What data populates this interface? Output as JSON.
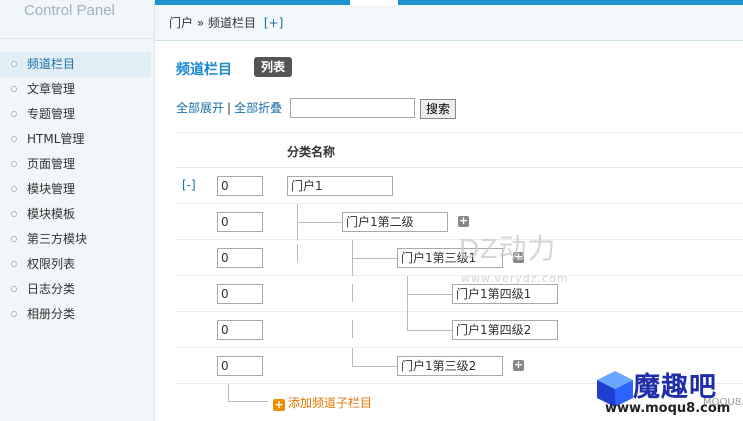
{
  "sidebar": {
    "title": "Control Panel",
    "items": [
      {
        "label": "频道栏目"
      },
      {
        "label": "文章管理"
      },
      {
        "label": "专题管理"
      },
      {
        "label": "HTML管理"
      },
      {
        "label": "页面管理"
      },
      {
        "label": "模块管理"
      },
      {
        "label": "模块模板"
      },
      {
        "label": "第三方模块"
      },
      {
        "label": "权限列表"
      },
      {
        "label": "日志分类"
      },
      {
        "label": "相册分类"
      }
    ]
  },
  "breadcrumb": {
    "root": "门户",
    "separator": "»",
    "current": "频道栏目",
    "add": "[+]"
  },
  "page": {
    "title": "频道栏目",
    "badge": "列表"
  },
  "toolbar": {
    "expand_all": "全部展开",
    "divider": "|",
    "collapse_all": "全部折叠",
    "search_value": "",
    "search_button": "搜索"
  },
  "table": {
    "header_name": "分类名称",
    "rows": [
      {
        "toggle": "[-]",
        "order": "0",
        "name": "门户1"
      },
      {
        "order": "0",
        "name": "门户1第二级"
      },
      {
        "order": "0",
        "name": "门户1第三级1"
      },
      {
        "order": "0",
        "name": "门户1第四级1"
      },
      {
        "order": "0",
        "name": "门户1第四级2"
      },
      {
        "order": "0",
        "name": "门户1第三级2"
      }
    ],
    "add_child": "添加频道子栏目",
    "add_icon": "+",
    "add_sub_icon": "+"
  },
  "watermark": {
    "text": "DZ动力",
    "sub": "www.verydz.com"
  },
  "logo": {
    "brand": "魔趣吧",
    "domain_small": "MOQU8.com",
    "url": "www.moqu8.com"
  },
  "colors": {
    "accent": "#1e93cf",
    "link": "#1a6fa5",
    "title": "#1a8ad1",
    "add": "#e07800"
  }
}
